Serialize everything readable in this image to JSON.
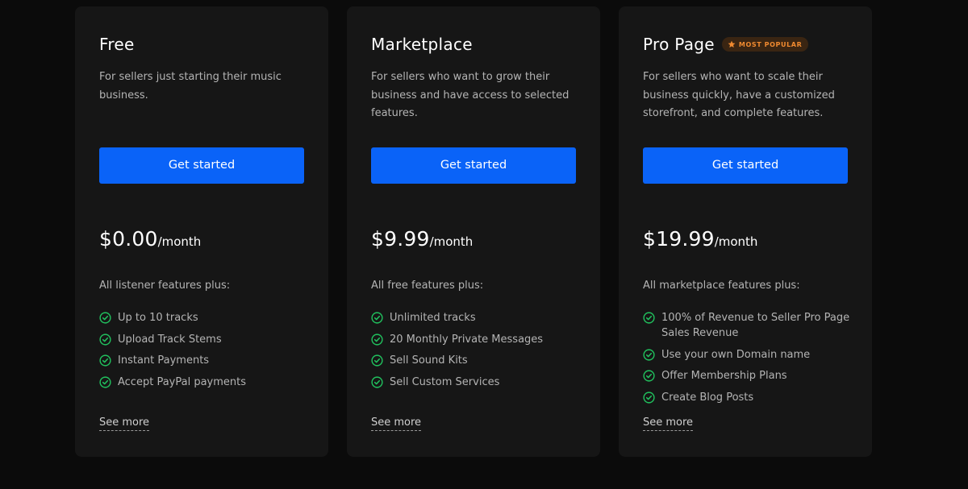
{
  "colors": {
    "background": "#0b0b0b",
    "card": "#161616",
    "button": "#0a63f8",
    "check": "#21c25e",
    "badge_text": "#f08a30",
    "badge_bg": "#3a2512"
  },
  "plans": [
    {
      "name": "Free",
      "description": "For sellers just starting their music business.",
      "cta_label": "Get started",
      "price": "$0.00",
      "period": "/month",
      "features_intro": "All listener features plus:",
      "features": [
        "Up to 10 tracks",
        "Upload Track Stems",
        "Instant Payments",
        "Accept PayPal payments"
      ],
      "see_more_label": "See more"
    },
    {
      "name": "Marketplace",
      "description": "For sellers who want to grow their business and have access to selected features.",
      "cta_label": "Get started",
      "price": "$9.99",
      "period": "/month",
      "features_intro": "All free features plus:",
      "features": [
        "Unlimited tracks",
        "20 Monthly Private Messages",
        "Sell Sound Kits",
        "Sell Custom Services"
      ],
      "see_more_label": "See more"
    },
    {
      "name": "Pro Page",
      "badge": {
        "icon": "star-icon",
        "label": "MOST POPULAR"
      },
      "description": "For sellers who want to scale their business quickly, have a customized storefront, and complete features.",
      "cta_label": "Get started",
      "price": "$19.99",
      "period": "/month",
      "features_intro": "All marketplace features plus:",
      "features": [
        "100% of Revenue to Seller Pro Page Sales Revenue",
        "Use your own Domain name",
        "Offer Membership Plans",
        "Create Blog Posts"
      ],
      "see_more_label": "See more"
    }
  ]
}
